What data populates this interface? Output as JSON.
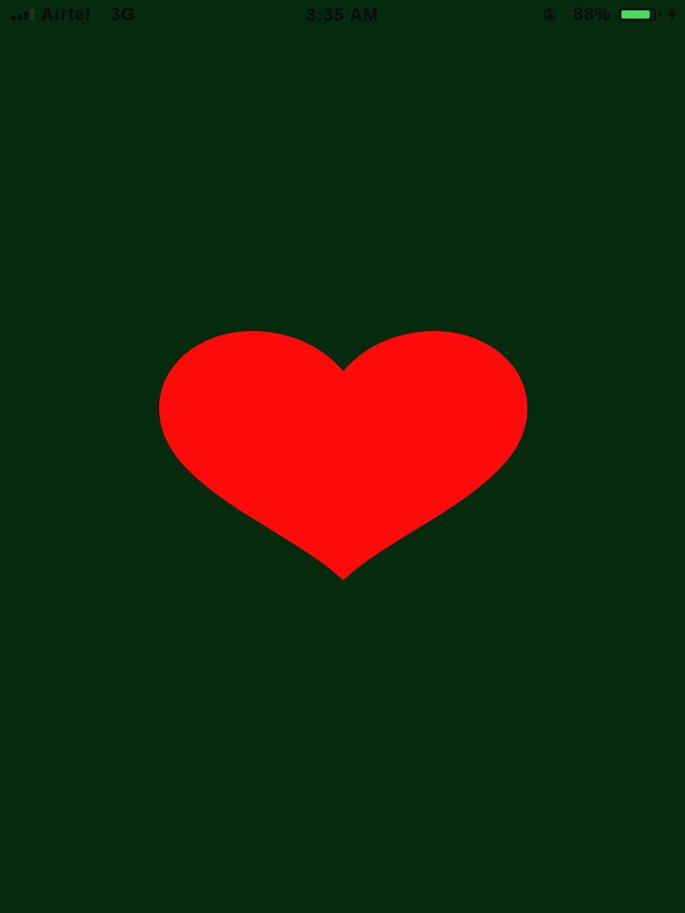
{
  "status_bar": {
    "carrier": "Airtel",
    "network": "3G",
    "time": "3:35 AM",
    "battery_percent": "88%",
    "battery_level": 0.88,
    "signal_bars_filled": 3,
    "signal_bars_total": 4,
    "icons": {
      "orientation_lock": "orientation-lock-icon",
      "charging": "lightning-bolt-icon"
    }
  },
  "main": {
    "shape": "heart",
    "colors": {
      "background": "#062a0d",
      "heart": "#ff0a0a",
      "battery_fill": "#4cd964"
    }
  }
}
